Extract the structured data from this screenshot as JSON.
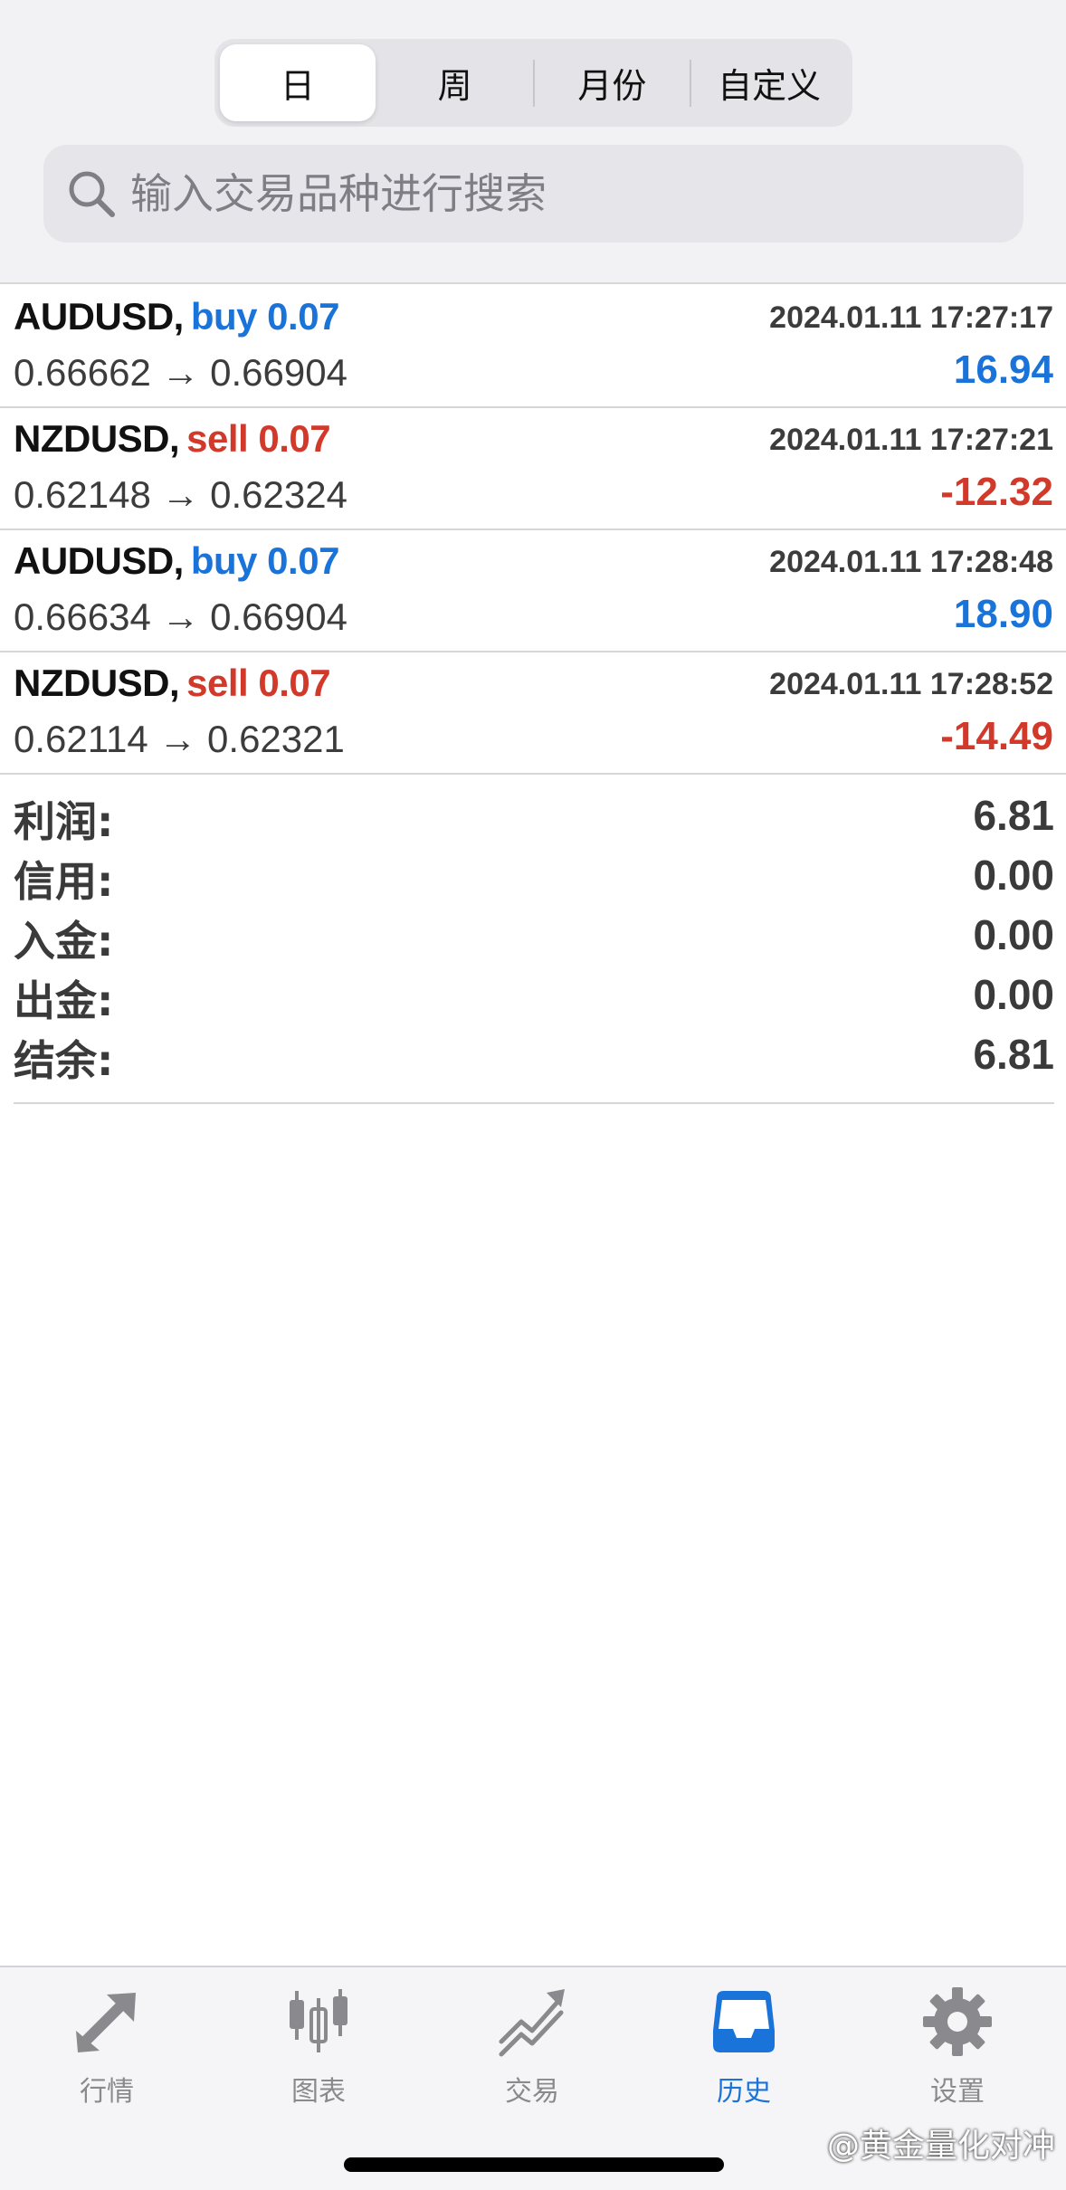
{
  "period_tabs": [
    "日",
    "周",
    "月份",
    "自定义"
  ],
  "search": {
    "placeholder": "输入交易品种进行搜索"
  },
  "trades": [
    {
      "symbol": "AUDUSD,",
      "side": "buy 0.07",
      "time": "2024.01.11 17:27:17",
      "prices": "0.66662 → 0.66904",
      "profit": "16.94"
    },
    {
      "symbol": "NZDUSD,",
      "side": "sell 0.07",
      "time": "2024.01.11 17:27:21",
      "prices": "0.62148 → 0.62324",
      "profit": "-12.32"
    },
    {
      "symbol": "AUDUSD,",
      "side": "buy 0.07",
      "time": "2024.01.11 17:28:48",
      "prices": "0.66634 → 0.66904",
      "profit": "18.90"
    },
    {
      "symbol": "NZDUSD,",
      "side": "sell 0.07",
      "time": "2024.01.11 17:28:52",
      "prices": "0.62114 → 0.62321",
      "profit": "-14.49"
    }
  ],
  "summary": [
    {
      "label": "利润:",
      "value": "6.81"
    },
    {
      "label": "信用:",
      "value": "0.00"
    },
    {
      "label": "入金:",
      "value": "0.00"
    },
    {
      "label": "出金:",
      "value": "0.00"
    },
    {
      "label": "结余:",
      "value": "6.81"
    }
  ],
  "tabbar": [
    {
      "label": "行情",
      "icon": "quotes-arrows-icon"
    },
    {
      "label": "图表",
      "icon": "candlestick-chart-icon"
    },
    {
      "label": "交易",
      "icon": "trade-trend-icon"
    },
    {
      "label": "历史",
      "icon": "history-inbox-icon",
      "active": true
    },
    {
      "label": "设置",
      "icon": "settings-gear-icon"
    }
  ],
  "watermark": "@黄金量化对冲",
  "colors": {
    "buy": "#1a73d9",
    "sell": "#d13a2a",
    "active_tab": "#1a73d9",
    "inactive_tab": "#8a8a8e"
  }
}
